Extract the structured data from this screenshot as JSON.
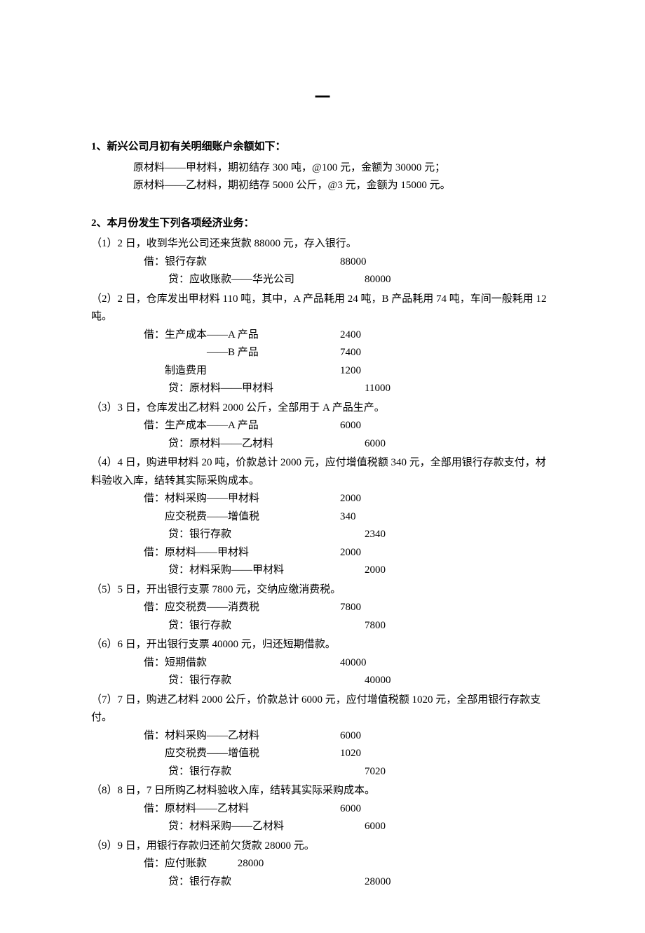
{
  "header_dash": "一",
  "section1": {
    "title": "1、新兴公司月初有关明细账户余额如下：",
    "lines": [
      "原材料——甲材料，期初结存 300 吨，@100 元，金额为 30000 元；",
      "原材料——乙材料，期初结存 5000 公斤，@3 元，金额为 15000 元。"
    ]
  },
  "section2": {
    "title": "2、本月份发生下列各项经济业务：",
    "t1": {
      "desc": "（1）2 日，收到华光公司还来货款 88000 元，存入银行。",
      "e": [
        {
          "type": "d",
          "label": "借：银行存款",
          "amt": "88000"
        },
        {
          "type": "c",
          "label": "贷：应收账款——华光公司",
          "amt": "80000"
        }
      ]
    },
    "t2": {
      "desc": "（2）2 日，仓库发出甲材料 110 吨，其中，A 产品耗用 24 吨，B 产品耗用 74 吨，车间一般耗用 12 吨。",
      "e": [
        {
          "type": "d",
          "label": "借：生产成本——A 产品",
          "amt": "2400"
        },
        {
          "type": "di",
          "label": "　　　　　　——B 产品",
          "amt": "7400"
        },
        {
          "type": "di",
          "label": "　　制造费用",
          "amt": "1200"
        },
        {
          "type": "c",
          "label": "贷：原材料——甲材料",
          "amt": "11000"
        }
      ]
    },
    "t3": {
      "desc": "（3）3 日，仓库发出乙材料 2000 公斤，全部用于 A 产品生产。",
      "e": [
        {
          "type": "d",
          "label": "借：生产成本——A 产品",
          "amt": "6000"
        },
        {
          "type": "c",
          "label": "贷：原材料——乙材料",
          "amt": "6000"
        }
      ]
    },
    "t4": {
      "desc": "（4）4 日，购进甲材料 20 吨，价款总计 2000 元，应付增值税额 340 元，全部用银行存款支付，材料验收入库，结转其实际采购成本。",
      "e": [
        {
          "type": "d",
          "label": "借：材料采购——甲材料",
          "amt": "2000"
        },
        {
          "type": "di",
          "label": "　　应交税费——增值税",
          "amt": "340"
        },
        {
          "type": "c",
          "label": "贷：银行存款",
          "amt": "2340"
        },
        {
          "type": "d",
          "label": "借：原材料——甲材料",
          "amt": "2000"
        },
        {
          "type": "c",
          "label": "贷：材料采购——甲材料",
          "amt": "2000"
        }
      ]
    },
    "t5": {
      "desc": "（5）5 日，开出银行支票 7800 元，交纳应缴消费税。",
      "e": [
        {
          "type": "d",
          "label": "借：应交税费——消费税",
          "amt": "7800"
        },
        {
          "type": "c",
          "label": "贷：银行存款",
          "amt": "7800"
        }
      ]
    },
    "t6": {
      "desc": "（6）6 日，开出银行支票 40000 元，归还短期借款。",
      "e": [
        {
          "type": "d",
          "label": "借：短期借款",
          "amt": "40000"
        },
        {
          "type": "c",
          "label": "贷：银行存款",
          "amt": "40000"
        }
      ]
    },
    "t7": {
      "desc": "（7）7 日，购进乙材料 2000 公斤，价款总计 6000 元，应付增值税额 1020 元，全部用银行存款支付。",
      "e": [
        {
          "type": "d",
          "label": "借：材料采购——乙材料",
          "amt": "6000"
        },
        {
          "type": "di",
          "label": "　　应交税费——增值税",
          "amt": "1020"
        },
        {
          "type": "c",
          "label": "贷：银行存款",
          "amt": "7020"
        }
      ]
    },
    "t8": {
      "desc": "（8）8 日，7 日所购乙材料验收入库，结转其实际采购成本。",
      "e": [
        {
          "type": "d",
          "label": "借：原材料——乙材料",
          "amt": "6000"
        },
        {
          "type": "c",
          "label": "贷：材料采购——乙材料",
          "amt": "6000"
        }
      ]
    },
    "t9": {
      "desc": "（9）9 日，用银行存款归还前欠货款 28000 元。",
      "e": [
        {
          "type": "d",
          "label": "借：应付账款",
          "amt": "28000",
          "short": true
        },
        {
          "type": "c",
          "label": "贷：银行存款",
          "amt": "28000"
        }
      ]
    }
  }
}
